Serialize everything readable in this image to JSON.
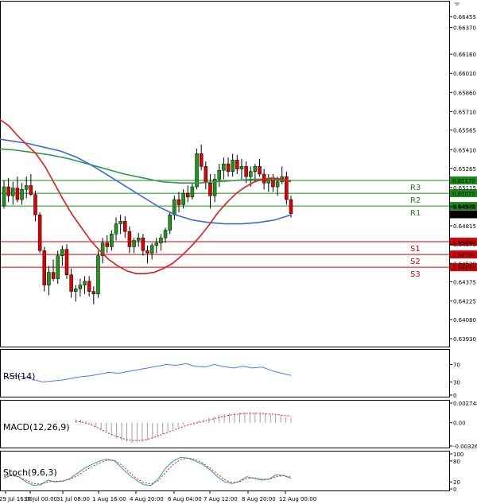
{
  "chart_data": {
    "type": "candlestick",
    "price_axis": {
      "ticks": [
        "0.66455",
        "0.66370",
        "0.66160",
        "0.66010",
        "0.65860",
        "0.65710",
        "0.65565",
        "0.65410",
        "0.65265",
        "0.65115",
        "0.64965",
        "0.64815",
        "0.64670",
        "0.64520",
        "0.64375",
        "0.64225",
        "0.64080",
        "0.63930"
      ],
      "ylim": [
        0.6388,
        0.6656
      ]
    },
    "time_axis": {
      "labels": [
        "29 Jul 16:00",
        "30 Jul 00:00",
        "31 Jul 08:00",
        "1 Aug 16:00",
        "4 Aug 20:00",
        "6 Aug 04:00",
        "7 Aug 12:00",
        "8 Aug 20:00",
        "12 Aug 00:00"
      ]
    },
    "current_price": "0.64905",
    "levels": [
      {
        "name": "R3",
        "value": "0.65170",
        "color": "#1a8a1a"
      },
      {
        "name": "R2",
        "value": "0.65070",
        "color": "#1a8a1a"
      },
      {
        "name": "R1",
        "value": "0.64970",
        "color": "#1a8a1a"
      },
      {
        "name": "S1",
        "value": "0.64690",
        "color": "#e00000"
      },
      {
        "name": "S2",
        "value": "0.64590",
        "color": "#e00000"
      },
      {
        "name": "S3",
        "value": "0.64490",
        "color": "#e00000"
      }
    ],
    "candles": [
      [
        0.6497,
        0.6517,
        0.6495,
        0.6512
      ],
      [
        0.6512,
        0.6519,
        0.65,
        0.6505
      ],
      [
        0.6505,
        0.6516,
        0.6498,
        0.6511
      ],
      [
        0.6511,
        0.652,
        0.65,
        0.6502
      ],
      [
        0.6502,
        0.6515,
        0.6498,
        0.651
      ],
      [
        0.651,
        0.652,
        0.6503,
        0.6513
      ],
      [
        0.6513,
        0.6522,
        0.6505,
        0.6506
      ],
      [
        0.6506,
        0.6509,
        0.6485,
        0.649
      ],
      [
        0.649,
        0.6492,
        0.646,
        0.6462
      ],
      [
        0.6462,
        0.6465,
        0.643,
        0.6435
      ],
      [
        0.6435,
        0.645,
        0.6427,
        0.6445
      ],
      [
        0.6445,
        0.6455,
        0.6438,
        0.644
      ],
      [
        0.644,
        0.6462,
        0.6436,
        0.6458
      ],
      [
        0.6458,
        0.6466,
        0.645,
        0.6463
      ],
      [
        0.6463,
        0.6467,
        0.644,
        0.6443
      ],
      [
        0.6443,
        0.6448,
        0.6425,
        0.643
      ],
      [
        0.643,
        0.6435,
        0.6422,
        0.6432
      ],
      [
        0.6432,
        0.644,
        0.6426,
        0.6435
      ],
      [
        0.6435,
        0.6442,
        0.6428,
        0.6438
      ],
      [
        0.6438,
        0.6442,
        0.6426,
        0.643
      ],
      [
        0.643,
        0.6434,
        0.642,
        0.6428
      ],
      [
        0.6428,
        0.6462,
        0.6425,
        0.6458
      ],
      [
        0.6458,
        0.6472,
        0.6452,
        0.6468
      ],
      [
        0.6468,
        0.6474,
        0.646,
        0.6465
      ],
      [
        0.6465,
        0.6478,
        0.6462,
        0.6475
      ],
      [
        0.6475,
        0.6488,
        0.647,
        0.6483
      ],
      [
        0.6483,
        0.649,
        0.6475,
        0.6485
      ],
      [
        0.6485,
        0.6489,
        0.6472,
        0.6477
      ],
      [
        0.6477,
        0.6481,
        0.646,
        0.6465
      ],
      [
        0.6465,
        0.6472,
        0.646,
        0.647
      ],
      [
        0.647,
        0.6476,
        0.6465,
        0.6472
      ],
      [
        0.6472,
        0.6475,
        0.6458,
        0.6462
      ],
      [
        0.6462,
        0.6466,
        0.6452,
        0.646
      ],
      [
        0.646,
        0.6468,
        0.6455,
        0.6466
      ],
      [
        0.6466,
        0.6472,
        0.646,
        0.6468
      ],
      [
        0.6468,
        0.6475,
        0.6462,
        0.6472
      ],
      [
        0.6472,
        0.648,
        0.6468,
        0.6478
      ],
      [
        0.6478,
        0.6492,
        0.6475,
        0.649
      ],
      [
        0.649,
        0.6505,
        0.6486,
        0.6502
      ],
      [
        0.6502,
        0.6508,
        0.6492,
        0.6498
      ],
      [
        0.6498,
        0.651,
        0.6495,
        0.6507
      ],
      [
        0.6507,
        0.6513,
        0.65,
        0.6504
      ],
      [
        0.6504,
        0.6515,
        0.6502,
        0.6512
      ],
      [
        0.6512,
        0.6542,
        0.651,
        0.6538
      ],
      [
        0.6538,
        0.6545,
        0.6525,
        0.6528
      ],
      [
        0.6528,
        0.6532,
        0.651,
        0.6515
      ],
      [
        0.6515,
        0.6522,
        0.6495,
        0.6505
      ],
      [
        0.6505,
        0.6522,
        0.65,
        0.6518
      ],
      [
        0.6518,
        0.653,
        0.6512,
        0.6525
      ],
      [
        0.6525,
        0.6535,
        0.6518,
        0.653
      ],
      [
        0.653,
        0.6535,
        0.652,
        0.6524
      ],
      [
        0.6524,
        0.6538,
        0.652,
        0.6533
      ],
      [
        0.6533,
        0.6537,
        0.6522,
        0.6526
      ],
      [
        0.6526,
        0.6534,
        0.6518,
        0.6528
      ],
      [
        0.6528,
        0.6532,
        0.6515,
        0.652
      ],
      [
        0.652,
        0.6528,
        0.6512,
        0.6524
      ],
      [
        0.6524,
        0.653,
        0.6516,
        0.6528
      ],
      [
        0.6528,
        0.6534,
        0.652,
        0.6522
      ],
      [
        0.6522,
        0.6526,
        0.651,
        0.6515
      ],
      [
        0.6515,
        0.6522,
        0.6508,
        0.6518
      ],
      [
        0.6518,
        0.6522,
        0.6508,
        0.6512
      ],
      [
        0.6512,
        0.652,
        0.6505,
        0.6516
      ],
      [
        0.6516,
        0.6528,
        0.6514,
        0.652
      ],
      [
        0.652,
        0.6524,
        0.6498,
        0.6502
      ],
      [
        0.6502,
        0.6505,
        0.6488,
        0.6491
      ]
    ],
    "ma_red": [
      0.6565,
      0.656,
      0.6552,
      0.6545,
      0.6538,
      0.6528,
      0.6515,
      0.6502,
      0.649,
      0.648,
      0.647,
      0.6462,
      0.6455,
      0.645,
      0.6446,
      0.6444,
      0.6444,
      0.6445,
      0.6448,
      0.6452,
      0.6458,
      0.6465,
      0.6473,
      0.6482,
      0.6492,
      0.65,
      0.6507,
      0.6512,
      0.6516,
      0.6518,
      0.6519,
      0.6518,
      0.6516
    ],
    "ma_blue": [
      0.655,
      0.6548,
      0.6546,
      0.6543,
      0.654,
      0.6535,
      0.6528,
      0.652,
      0.6512,
      0.6504,
      0.6496,
      0.649,
      0.6486,
      0.6484,
      0.6483,
      0.6483,
      0.6484,
      0.6486,
      0.649
    ],
    "ma_green": [
      0.6542,
      0.6541,
      0.6539,
      0.6537,
      0.6534,
      0.653,
      0.6526,
      0.6522,
      0.6519,
      0.6516,
      0.6515,
      0.6515,
      0.6516,
      0.6517,
      0.6518,
      0.6518,
      0.6517
    ],
    "indicators": {
      "rsi": {
        "label": "RSI(14)",
        "ticks": [
          "70",
          "30",
          "0"
        ],
        "values": [
          38,
          45,
          42,
          36,
          30,
          32,
          34,
          38,
          42,
          44,
          48,
          52,
          50,
          54,
          58,
          62,
          66,
          70,
          68,
          72,
          66,
          64,
          70,
          65,
          62,
          66,
          62,
          64,
          56,
          50,
          45
        ]
      },
      "macd": {
        "label": "MACD(12,26,9)",
        "ticks": [
          "0.002748",
          "0.00",
          "-0.003263"
        ],
        "values": [
          0.0005,
          0.0004,
          0.0002,
          -0.0002,
          -0.0006,
          -0.001,
          -0.0014,
          -0.0018,
          -0.0022,
          -0.0025,
          -0.0027,
          -0.0028,
          -0.0028,
          -0.0027,
          -0.0025,
          -0.0022,
          -0.0019,
          -0.0016,
          -0.0012,
          -0.0009,
          -0.0006,
          -0.0003,
          -0.0001,
          0.0001,
          0.0003,
          0.0005,
          0.0007,
          0.0009,
          0.0011,
          0.0012,
          0.0013,
          0.0014,
          0.0014,
          0.0014,
          0.0014,
          0.0014,
          0.0013,
          0.0013,
          0.0012,
          0.0011,
          0.001,
          0.0008,
          0.0007
        ],
        "signal": [
          0.0002,
          0.0001,
          -0.0001,
          -0.0004,
          -0.0008,
          -0.0012,
          -0.0016,
          -0.0019,
          -0.0022,
          -0.0024,
          -0.0025,
          -0.0025,
          -0.0024,
          -0.0022,
          -0.0019,
          -0.0016,
          -0.0013,
          -0.001,
          -0.0007,
          -0.0004,
          -0.0002,
          0.0,
          0.0002,
          0.0004,
          0.0006,
          0.0008,
          0.001,
          0.0011,
          0.0012,
          0.0013,
          0.0013,
          0.0013,
          0.0013,
          0.0012,
          0.0012,
          0.0011,
          0.001,
          0.0009
        ]
      },
      "stoch": {
        "label": "Stoch(9,6,3)",
        "ticks": [
          "100",
          "80",
          "20",
          "0"
        ],
        "k": [
          30,
          40,
          35,
          20,
          10,
          12,
          25,
          20,
          22,
          30,
          45,
          60,
          70,
          80,
          85,
          80,
          60,
          40,
          25,
          12,
          10,
          30,
          60,
          80,
          90,
          88,
          80,
          70,
          55,
          35,
          20,
          15,
          22,
          35,
          30,
          25,
          28,
          40,
          38,
          30
        ],
        "d": [
          35,
          38,
          34,
          25,
          15,
          14,
          20,
          22,
          23,
          28,
          38,
          52,
          64,
          74,
          82,
          82,
          68,
          48,
          30,
          18,
          14,
          24,
          48,
          70,
          84,
          88,
          84,
          74,
          60,
          42,
          26,
          18,
          20,
          30,
          32,
          28,
          27,
          35,
          38,
          34
        ]
      }
    }
  }
}
